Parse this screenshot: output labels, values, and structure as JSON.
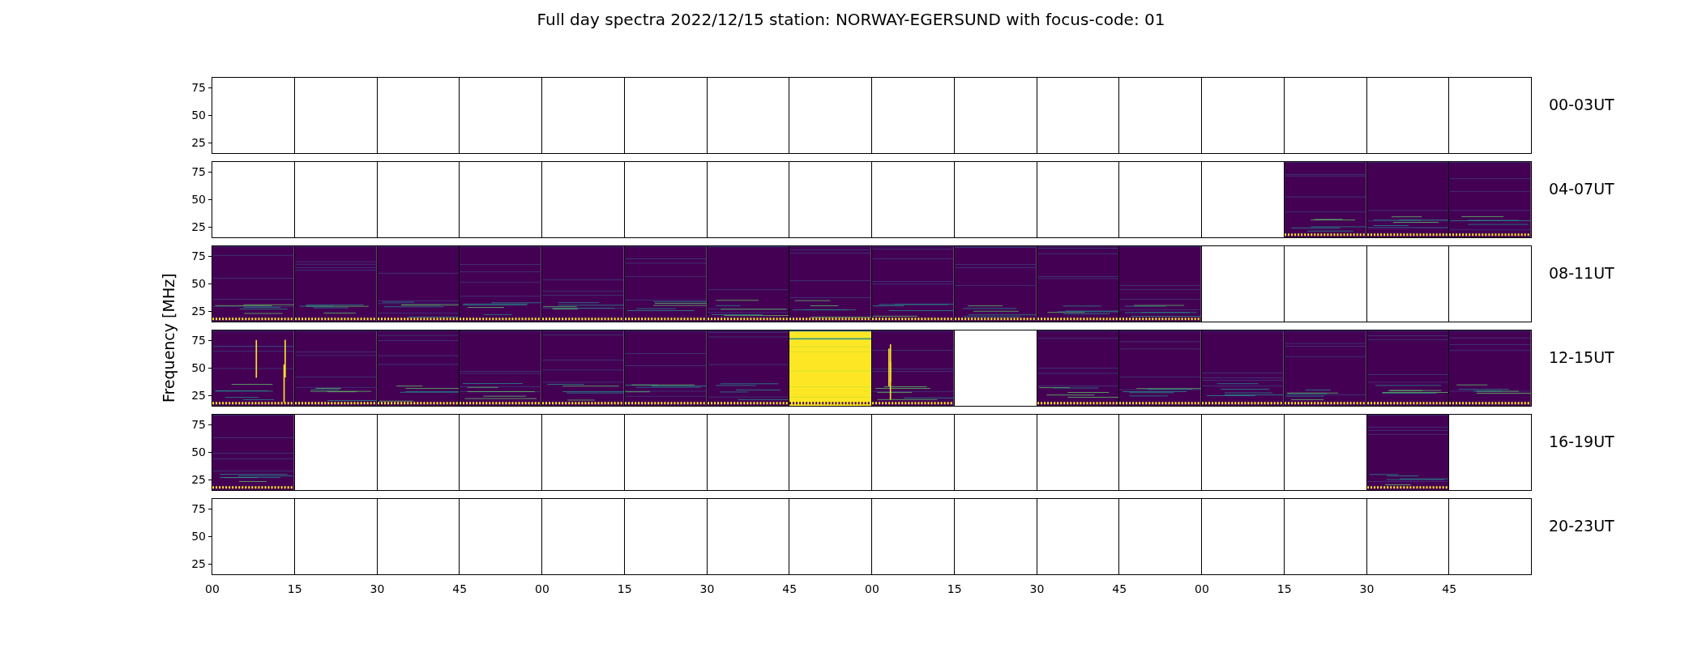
{
  "title": "Full day spectra 2022/12/15 station: NORWAY-EGERSUND with focus-code: 01",
  "ylabel": "Frequency [MHz]",
  "rows": [
    {
      "label": "00-03UT",
      "y_ticks": [
        "75",
        "50",
        "25"
      ],
      "panels": [
        {
          "kind": "empty"
        },
        {
          "kind": "empty"
        },
        {
          "kind": "empty"
        },
        {
          "kind": "empty"
        },
        {
          "kind": "empty"
        },
        {
          "kind": "empty"
        },
        {
          "kind": "empty"
        },
        {
          "kind": "empty"
        },
        {
          "kind": "empty"
        },
        {
          "kind": "empty"
        },
        {
          "kind": "empty"
        },
        {
          "kind": "empty"
        },
        {
          "kind": "empty"
        },
        {
          "kind": "empty"
        },
        {
          "kind": "empty"
        },
        {
          "kind": "empty"
        }
      ]
    },
    {
      "label": "04-07UT",
      "y_ticks": [
        "75",
        "50",
        "25"
      ],
      "panels": [
        {
          "kind": "empty"
        },
        {
          "kind": "empty"
        },
        {
          "kind": "empty"
        },
        {
          "kind": "empty"
        },
        {
          "kind": "empty"
        },
        {
          "kind": "empty"
        },
        {
          "kind": "empty"
        },
        {
          "kind": "empty"
        },
        {
          "kind": "empty"
        },
        {
          "kind": "empty"
        },
        {
          "kind": "empty"
        },
        {
          "kind": "empty"
        },
        {
          "kind": "empty"
        },
        {
          "kind": "spectrum"
        },
        {
          "kind": "spectrum"
        },
        {
          "kind": "spectrum"
        }
      ]
    },
    {
      "label": "08-11UT",
      "y_ticks": [
        "75",
        "50",
        "25"
      ],
      "panels": [
        {
          "kind": "spectrum"
        },
        {
          "kind": "spectrum"
        },
        {
          "kind": "spectrum"
        },
        {
          "kind": "spectrum"
        },
        {
          "kind": "spectrum"
        },
        {
          "kind": "spectrum"
        },
        {
          "kind": "spectrum"
        },
        {
          "kind": "spectrum"
        },
        {
          "kind": "spectrum"
        },
        {
          "kind": "spectrum"
        },
        {
          "kind": "spectrum"
        },
        {
          "kind": "spectrum"
        },
        {
          "kind": "empty"
        },
        {
          "kind": "empty"
        },
        {
          "kind": "empty"
        },
        {
          "kind": "empty"
        }
      ]
    },
    {
      "label": "12-15UT",
      "y_ticks": [
        "75",
        "50",
        "25"
      ],
      "panels": [
        {
          "kind": "striped"
        },
        {
          "kind": "spectrum"
        },
        {
          "kind": "spectrum"
        },
        {
          "kind": "spectrum"
        },
        {
          "kind": "spectrum"
        },
        {
          "kind": "spectrum"
        },
        {
          "kind": "spectrum"
        },
        {
          "kind": "saturated"
        },
        {
          "kind": "striped"
        },
        {
          "kind": "empty"
        },
        {
          "kind": "spectrum"
        },
        {
          "kind": "spectrum"
        },
        {
          "kind": "spectrum"
        },
        {
          "kind": "spectrum"
        },
        {
          "kind": "spectrum"
        },
        {
          "kind": "spectrum"
        }
      ]
    },
    {
      "label": "16-19UT",
      "y_ticks": [
        "75",
        "50",
        "25"
      ],
      "panels": [
        {
          "kind": "spectrum"
        },
        {
          "kind": "empty"
        },
        {
          "kind": "empty"
        },
        {
          "kind": "empty"
        },
        {
          "kind": "empty"
        },
        {
          "kind": "empty"
        },
        {
          "kind": "empty"
        },
        {
          "kind": "empty"
        },
        {
          "kind": "empty"
        },
        {
          "kind": "empty"
        },
        {
          "kind": "empty"
        },
        {
          "kind": "empty"
        },
        {
          "kind": "empty"
        },
        {
          "kind": "empty"
        },
        {
          "kind": "spectrum"
        },
        {
          "kind": "empty"
        }
      ]
    },
    {
      "label": "20-23UT",
      "y_ticks": [
        "75",
        "50",
        "25"
      ],
      "panels": [
        {
          "kind": "empty"
        },
        {
          "kind": "empty"
        },
        {
          "kind": "empty"
        },
        {
          "kind": "empty"
        },
        {
          "kind": "empty"
        },
        {
          "kind": "empty"
        },
        {
          "kind": "empty"
        },
        {
          "kind": "empty"
        },
        {
          "kind": "empty"
        },
        {
          "kind": "empty"
        },
        {
          "kind": "empty"
        },
        {
          "kind": "empty"
        },
        {
          "kind": "empty"
        },
        {
          "kind": "empty"
        },
        {
          "kind": "empty"
        },
        {
          "kind": "empty"
        }
      ]
    }
  ],
  "x_ticks": [
    "00",
    "15",
    "30",
    "45",
    "00",
    "15",
    "30",
    "45",
    "00",
    "15",
    "30",
    "45",
    "00",
    "15",
    "30",
    "45"
  ]
}
